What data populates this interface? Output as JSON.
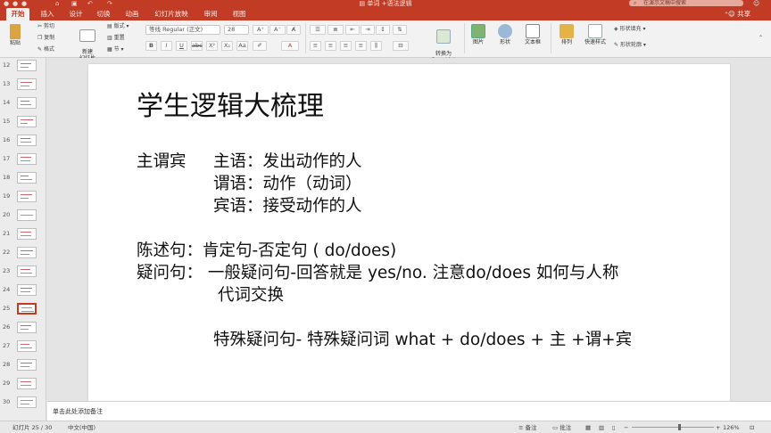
{
  "window": {
    "title": "单词 +语法逻辑",
    "search_placeholder": "在演示文稿中搜索"
  },
  "menu": {
    "tabs": [
      "开始",
      "插入",
      "设计",
      "切换",
      "动画",
      "幻灯片放映",
      "审阅",
      "视图"
    ],
    "active_tab": "开始",
    "share_label": "共享"
  },
  "ribbon": {
    "paste": "粘贴",
    "cut": "剪切",
    "copy": "复制",
    "format": "格式",
    "new_slide": "新建\n幻灯片",
    "layout": "版式",
    "reset": "重置",
    "section": "节",
    "font_name": "等线 Regular (正文)",
    "font_size": "28",
    "convert_smartart": "转换为\nSmartArt",
    "picture": "图片",
    "shape": "形状",
    "textbox": "文本框",
    "arrange": "排列",
    "quick_styles": "快速样式",
    "shape_fill": "形状填充",
    "shape_outline": "形状轮廓"
  },
  "sorter": {
    "slide_numbers": [
      "12",
      "13",
      "14",
      "15",
      "16",
      "17",
      "18",
      "19",
      "20",
      "21",
      "22",
      "23",
      "24",
      "25",
      "26",
      "27",
      "28",
      "29",
      "30"
    ],
    "selected": "25"
  },
  "slide": {
    "title": "学生逻辑大梳理",
    "line1_label": "主谓宾",
    "line1_text": "主语：发出动作的人",
    "line2_text": "谓语：动作（动词）",
    "line3_text": "宾语：接受动作的人",
    "line4": "陈述句：肯定句-否定句 ( do/does)",
    "line5": "疑问句： 一般疑问句-回答就是 yes/no. 注意do/does 如何与人称",
    "line6": "代词交换",
    "line7": "特殊疑问句- 特殊疑问词 what + do/does + 主 +谓+宾"
  },
  "notes": {
    "placeholder": "单击此处添加备注"
  },
  "status": {
    "slide_count": "幻灯片 25 / 30",
    "language": "中文(中国)",
    "notes_btn": "备注",
    "comments_btn": "批注",
    "zoom": "126%"
  },
  "colors": {
    "accent": "#c13b25"
  }
}
